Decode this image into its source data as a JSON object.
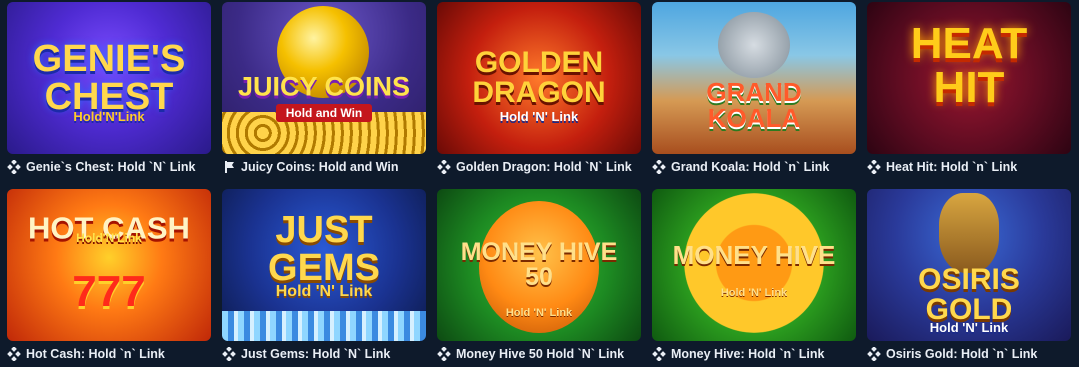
{
  "games": [
    {
      "caption": "Genie`s Chest: Hold `N` Link",
      "logo": "Genie's Chest",
      "sub": "Hold'N'Link",
      "provider_icon": "diamond-cluster-icon"
    },
    {
      "caption": "Juicy Coins: Hold and Win",
      "logo": "Juicy Coins",
      "sub": "Hold and Win",
      "provider_icon": "flag-icon"
    },
    {
      "caption": "Golden Dragon: Hold `N` Link",
      "logo": "Golden Dragon",
      "sub": "Hold 'N' Link",
      "provider_icon": "diamond-cluster-icon"
    },
    {
      "caption": "Grand Koala: Hold `n` Link",
      "logo": "Grand Koala",
      "sub": "",
      "provider_icon": "diamond-cluster-icon"
    },
    {
      "caption": "Heat Hit: Hold `n` Link",
      "logo": "Heat Hit",
      "sub": "",
      "provider_icon": "diamond-cluster-icon"
    },
    {
      "caption": "Hot Cash: Hold `n` Link",
      "logo": "Hot Cash",
      "sub": "Hold'N'Link",
      "sevens": "777",
      "provider_icon": "diamond-cluster-icon"
    },
    {
      "caption": "Just Gems: Hold `N` Link",
      "logo": "Just Gems",
      "sub": "Hold 'N' Link",
      "provider_icon": "diamond-cluster-icon"
    },
    {
      "caption": "Money Hive 50 Hold `N` Link",
      "logo": "Money Hive 50",
      "sub": "Hold 'N' Link",
      "provider_icon": "diamond-cluster-icon"
    },
    {
      "caption": "Money Hive: Hold `n` Link",
      "logo": "Money Hive",
      "sub": "Hold 'N' Link",
      "provider_icon": "diamond-cluster-icon"
    },
    {
      "caption": "Osiris Gold: Hold `n` Link",
      "logo": "Osiris Gold",
      "sub": "Hold 'N' Link",
      "provider_icon": "diamond-cluster-icon"
    }
  ],
  "colors": {
    "background": "#0e1a2b",
    "caption_text": "#e9eef5"
  }
}
